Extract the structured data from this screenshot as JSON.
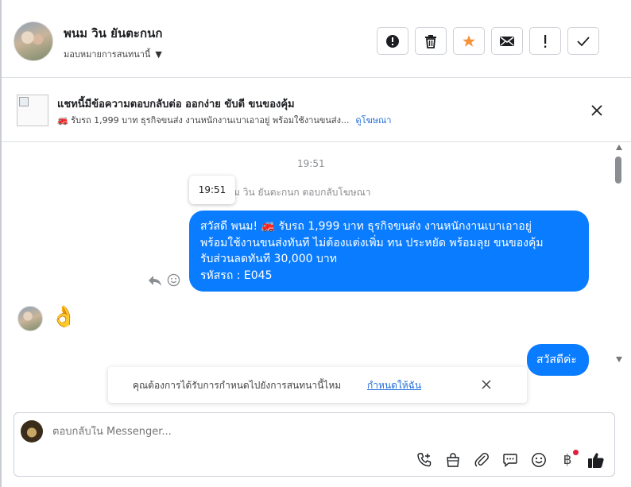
{
  "header": {
    "contact_name": "พนม วิน ยันตะกนก",
    "assign_label": "มอบหมายการสนทนานี้",
    "actions": [
      {
        "icon": "alert-circle-icon",
        "name": "mark-spam-button"
      },
      {
        "icon": "trash-icon",
        "name": "delete-button"
      },
      {
        "icon": "star-icon",
        "name": "star-button"
      },
      {
        "icon": "envelope-icon",
        "name": "mark-unread-button"
      },
      {
        "icon": "exclamation-icon",
        "name": "follow-up-button"
      },
      {
        "icon": "check-icon",
        "name": "done-button"
      }
    ],
    "star_color": "#f7923b"
  },
  "ad": {
    "title": "แชทนี้มีข้อความตอบกลับต่อ ออกง่าย ขับดี ขนของคุ้ม",
    "subtitle": "🚒 รับรถ 1,999 บาท ธุรกิจขนส่ง งานหนักงานเบาเอาอยู่ พร้อมใช้งานขนส่ง...",
    "link": "ดูโฆษณา"
  },
  "chat": {
    "timestamp": "19:51",
    "tooltip_time": "19:51",
    "reply_label": "ม วิน ยันตะกนก ตอบกลับโฆษณา",
    "main_message_lines": [
      "สวัสดี พนม! 🚒 รับรถ 1,999 บาท ธุรกิจขนส่ง งานหนักงานเบาเอาอยู่",
      "พร้อมใช้งานขนส่งทันที ไม่ต้องแต่งเพิ่ม ทน ประหยัด พร้อมลุย ขนของคุ้ม",
      "รับส่วนลดทันที 30,000 บาท",
      "รหัสรถ : E045"
    ],
    "customer_reaction": "👌",
    "small_message": "สวัสดีค่ะ",
    "bubble_color": "#0a7cff"
  },
  "notice": {
    "text": "คุณต้องการได้รับการกำหนดไปยังการสนทนานี้ไหม",
    "link": "กำหนดให้ฉัน"
  },
  "composer": {
    "placeholder": "ตอบกลับใน Messenger...",
    "tools": [
      "call-icon",
      "shopping-bag-icon",
      "paperclip-icon",
      "saved-replies-icon",
      "emoji-icon",
      "baht-icon",
      "thumbs-up-icon"
    ],
    "baht_symbol": "฿"
  }
}
